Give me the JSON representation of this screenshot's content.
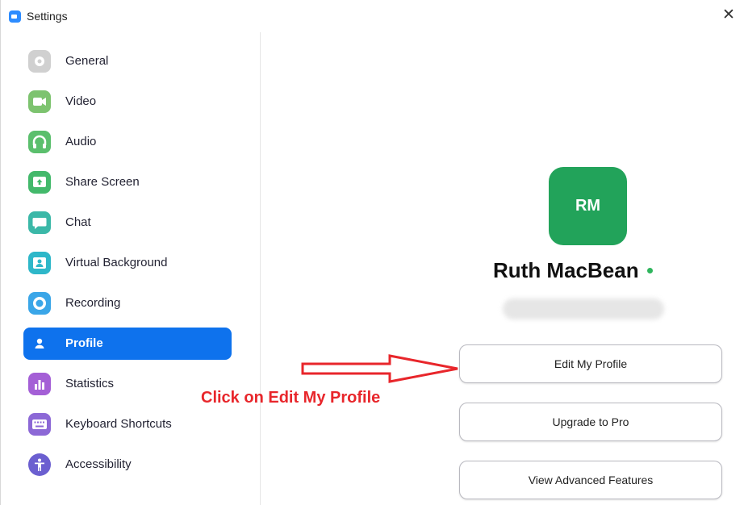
{
  "window": {
    "title": "Settings",
    "close_glyph": "✕"
  },
  "sidebar": {
    "items": [
      {
        "label": "General",
        "icon": "gear-icon",
        "color": "#d0d0d0"
      },
      {
        "label": "Video",
        "icon": "video-icon",
        "color": "#7dc36f"
      },
      {
        "label": "Audio",
        "icon": "headphones-icon",
        "color": "#5bbf6d"
      },
      {
        "label": "Share Screen",
        "icon": "share-screen-icon",
        "color": "#43b96b"
      },
      {
        "label": "Chat",
        "icon": "chat-icon",
        "color": "#3bb8a8"
      },
      {
        "label": "Virtual Background",
        "icon": "virtual-background-icon",
        "color": "#2eb7c9"
      },
      {
        "label": "Recording",
        "icon": "recording-icon",
        "color": "#3aa6e8"
      },
      {
        "label": "Profile",
        "icon": "user-icon",
        "color": "#ffffff",
        "active": true
      },
      {
        "label": "Statistics",
        "icon": "statistics-icon",
        "color": "#a45fd6"
      },
      {
        "label": "Keyboard Shortcuts",
        "icon": "keyboard-icon",
        "color": "#8c68d6"
      },
      {
        "label": "Accessibility",
        "icon": "accessibility-icon",
        "color": "#6b5fd0"
      }
    ]
  },
  "profile": {
    "initials": "RM",
    "avatar_color": "#22a35a",
    "name": "Ruth MacBean",
    "status_color": "#2fb55d",
    "buttons": {
      "edit": "Edit My Profile",
      "upgrade": "Upgrade to Pro",
      "advanced": "View Advanced Features"
    }
  },
  "annotation": {
    "text": "Click on Edit My Profile",
    "color": "#e8262b"
  }
}
